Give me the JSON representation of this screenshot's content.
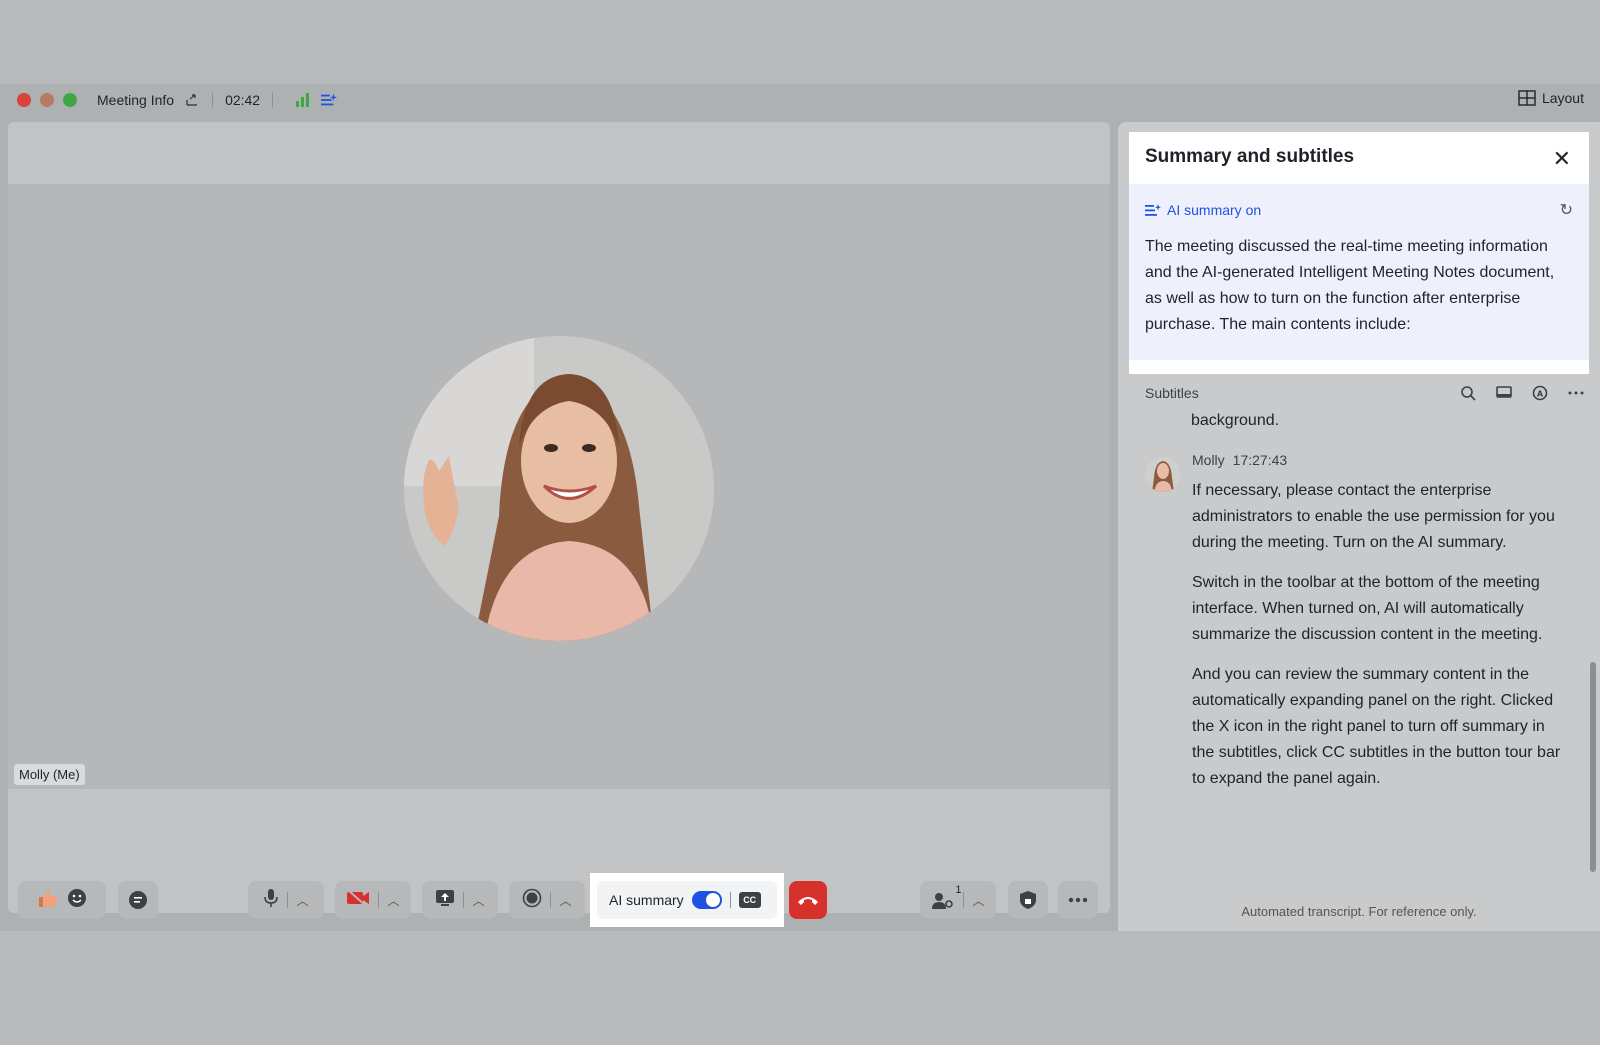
{
  "titlebar": {
    "meeting_info": "Meeting Info",
    "timer": "02:42",
    "layout_label": "Layout"
  },
  "stage": {
    "participant_name": "Molly (Me)"
  },
  "toolbar": {
    "ai_summary_label": "AI summary",
    "ai_summary_on": true,
    "cc_label": "CC",
    "participants_count": "1"
  },
  "panel": {
    "title": "Summary and subtitles",
    "ai_status": "AI summary on",
    "summary_text": "The meeting discussed the real-time meeting information and the AI-generated Intelligent Meeting Notes document, as well as how to turn on the function after enterprise purchase. The main contents include:",
    "subtitles_label": "Subtitles",
    "prev_fragment": "background.",
    "message": {
      "speaker": "Molly",
      "time": "17:27:43",
      "paragraphs": [
        "If necessary, please contact the enterprise administrators to enable the use permission for you during the meeting. Turn on the AI summary.",
        "Switch in the toolbar at the bottom of the meeting interface. When turned on, AI will automatically summarize the discussion content in the meeting.",
        "And you can review the summary content in the automatically expanding panel on the right. Clicked the X icon in the right panel to turn off summary in the subtitles, click CC subtitles in the button tour bar to expand the panel again."
      ]
    },
    "footnote": "Automated transcript. For reference only."
  },
  "colors": {
    "accent": "#1f52e0",
    "hangup": "#d7312c",
    "summary_bg": "#eef1fb"
  }
}
